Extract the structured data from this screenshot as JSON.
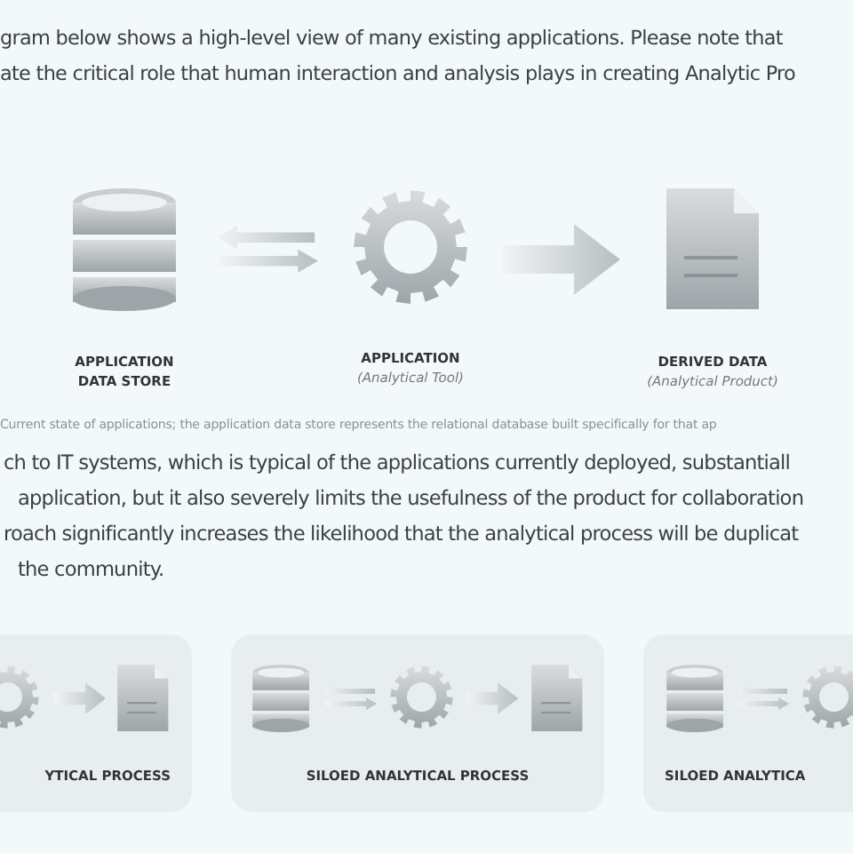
{
  "intro": [
    "gram below shows a high-level view of many existing applications. Please note that",
    "ate the critical role that human interaction and analysis plays in creating Analytic Pro"
  ],
  "diagram": {
    "nodes": [
      {
        "kind": "database",
        "title": [
          "APPLICATION",
          "DATA STORE"
        ]
      },
      {
        "kind": "gear",
        "title": [
          "APPLICATION"
        ],
        "note": "(Analytical Tool)"
      },
      {
        "kind": "document",
        "title": [
          "DERIVED DATA"
        ],
        "note": "(Analytical Product)"
      }
    ],
    "connectors": [
      {
        "kind": "two-way"
      },
      {
        "kind": "one-way"
      }
    ],
    "caption": "Current state of applications; the application data store represents the relational database built specifically for that ap"
  },
  "paragraph": [
    "ch to IT systems, which is typical of the applications currently deployed, substantiall",
    "application, but it also severely limits the usefulness of the product for collaboration",
    "roach significantly increases the likelihood that the analytical process will be duplicat",
    "the community."
  ],
  "panels": [
    {
      "label": "YTICAL PROCESS",
      "parts": [
        {
          "kind": "gear"
        },
        {
          "kind": "one-way"
        },
        {
          "kind": "document"
        }
      ]
    },
    {
      "label": "SILOED ANALYTICAL PROCESS",
      "parts": [
        {
          "kind": "database"
        },
        {
          "kind": "two-way"
        },
        {
          "kind": "gear"
        },
        {
          "kind": "one-way"
        },
        {
          "kind": "document"
        }
      ]
    },
    {
      "label": "SILOED ANALYTICA",
      "parts": [
        {
          "kind": "database"
        },
        {
          "kind": "two-way"
        },
        {
          "kind": "gear"
        }
      ]
    }
  ]
}
